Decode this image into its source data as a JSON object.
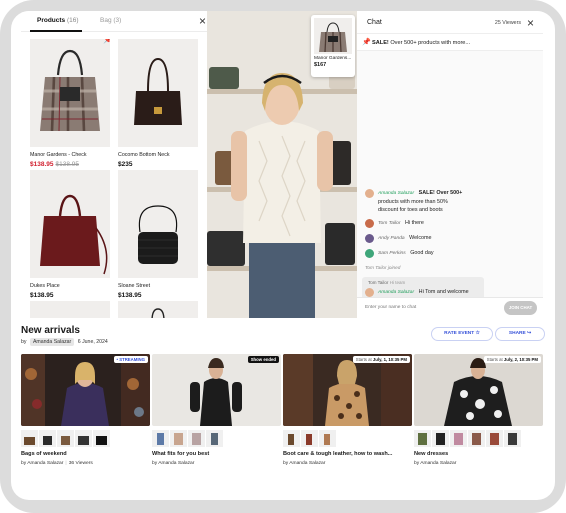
{
  "products_panel": {
    "tabs": [
      {
        "label": "Products",
        "count": "(16)"
      },
      {
        "label": "Bag",
        "count": "(3)"
      }
    ],
    "close_label": "×",
    "items": [
      {
        "name": "Manor Gardens - Check",
        "price": "$138.95",
        "old_price": "$138.95",
        "sale": true,
        "pinned": true
      },
      {
        "name": "Cocomo Bottom Neck",
        "price": "$235",
        "old_price": "",
        "sale": false,
        "pinned": false
      },
      {
        "name": "Dukes Place",
        "price": "$138.95",
        "old_price": "",
        "sale": false,
        "pinned": false
      },
      {
        "name": "Sloane Street",
        "price": "$138.95",
        "old_price": "",
        "sale": false,
        "pinned": false
      }
    ]
  },
  "video": {
    "featured_product": {
      "name": "Manor Gardens...",
      "price": "$167"
    }
  },
  "chat": {
    "title": "Chat",
    "viewers": "25 Viewers",
    "close_label": "×",
    "pinned": {
      "bold": "SALE!",
      "text": " Over 500+ products with more..."
    },
    "messages": [
      {
        "user": "Amanda Salazar",
        "text": "SALE! Over 500+",
        "text2": "products with more than    50%",
        "text3": "discount for toes and boots",
        "host": true
      },
      {
        "user": "Tom Tailor",
        "text": "Hi there",
        "host": false
      },
      {
        "user": "Andy Panda",
        "text": "Welcome",
        "host": false
      },
      {
        "user": "Sam Perkins",
        "text": "Good day",
        "host": false
      }
    ],
    "joined": "Tom Tailor joined",
    "reply": {
      "quote_user": "Tom Tailor",
      "quote_text": "Hi team",
      "user": "Amanda Salazar",
      "text": "Hi Tom and welcome"
    },
    "input_placeholder": "Enter your name to chat",
    "join_label": "JOIN CHAT"
  },
  "new_arrivals": {
    "title": "New arrivals",
    "by_prefix": "by",
    "author": "Amanda Salazar",
    "date": "6 June, 2024",
    "rate_label": "RATE EVENT",
    "share_label": "SHARE",
    "events": [
      {
        "title": "Bags of weekend",
        "by": "by Amanda Salazar",
        "viewers": "36 Viewers",
        "tag": "• STREAMING",
        "tag_type": "live"
      },
      {
        "title": "What fits for you best",
        "by": "by Amanda Salazar",
        "viewers": "",
        "tag": "Show ended",
        "tag_type": "ended"
      },
      {
        "title": "Boot care & tough leather, how to wash...",
        "by": "by Amanda Salazar",
        "viewers": "",
        "tag_prefix": "Starts at ",
        "tag": "July, 1, 10:35 PM",
        "tag_type": "starts"
      },
      {
        "title": "New dresses",
        "by": "by Amanda Salazar",
        "viewers": "",
        "tag_prefix": "Starts at ",
        "tag": "July, 2, 10:35 PM",
        "tag_type": "starts"
      }
    ]
  },
  "colors": {
    "accent": "#3550d8",
    "sale": "#d1202f",
    "host_name": "#1e9e5a"
  }
}
